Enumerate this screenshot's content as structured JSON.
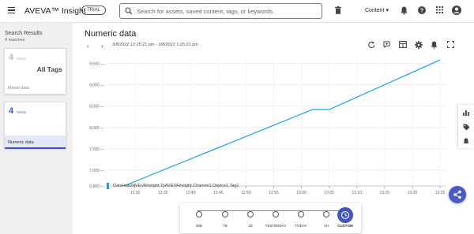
{
  "app": {
    "brand": "AVEVA™ Insight",
    "trial_badge": "TRIAL",
    "search_placeholder": "Search for assets, saved content, tags, or keywords.",
    "content_menu": "Content"
  },
  "sidebar": {
    "title": "Search Results",
    "subtitle": "4 matches",
    "cards": [
      {
        "count": "4",
        "tags_label": "TAGS",
        "heading": "All Tags",
        "name": "Mixed data",
        "selected": false
      },
      {
        "count": "4",
        "tags_label": "TAGS",
        "heading": "",
        "name": "Numeric data",
        "selected": true
      }
    ]
  },
  "main": {
    "title": "Numeric data",
    "time_range": "3/8/2022 12:25:21 pm - 3/8/2022 1:25:21 pm"
  },
  "chart_data": {
    "type": "line",
    "title": "",
    "xlabel": "",
    "ylabel": "",
    "x_ticks": [
      "12:30",
      "12:35",
      "12:40",
      "12:45",
      "12:50",
      "12:55",
      "13:00",
      "13:05",
      "13:10",
      "13:15",
      "13:20",
      "13:25"
    ],
    "y_ticks": [
      6900,
      7000,
      7500,
      8000,
      8500,
      9000,
      9500
    ],
    "y_tick_labels": [
      "6,900 —",
      "7,000 —",
      "7,500 —",
      "8,000 —",
      "8,500 —",
      "9,000 —",
      "9,500 —"
    ],
    "series": [
      {
        "name": "DataHub2AVEVAInsight.ToAVEVAInsight.Channel1.Device1.Tag1",
        "color": "#1aa2e0",
        "points": [
          [
            "12:28",
            6900
          ],
          [
            "13:02",
            8420
          ],
          [
            "13:05",
            8420
          ],
          [
            "13:25",
            9580
          ]
        ]
      }
    ],
    "ylim": [
      6900,
      9600
    ],
    "grid": true,
    "legend_position": "bottom-left"
  },
  "time_options": [
    {
      "label": "30D",
      "active": false
    },
    {
      "label": "7D",
      "active": false
    },
    {
      "label": "1D",
      "active": false
    },
    {
      "label": "YESTERDAY",
      "active": false
    },
    {
      "label": "TODAY",
      "active": false
    },
    {
      "label": "1H",
      "active": false
    },
    {
      "label": "CUSTOM",
      "active": true
    }
  ],
  "colors": {
    "accent": "#4a5cc4",
    "series": "#1aa2e0",
    "selected_card": "#4055c2"
  }
}
